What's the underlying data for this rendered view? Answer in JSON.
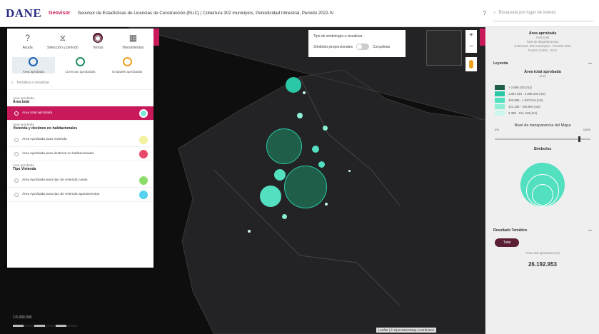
{
  "header": {
    "logo": "DANE",
    "logo_sub": "",
    "brand": "Geovisor",
    "title": "Geovisor de Estadísticas de Licencias de Construcción (ELIC) | Cobertura 302 municipios, Periodicidad trimestral, Periodo 2022-IV",
    "info": "?",
    "search_placeholder": "Búsqueda por lugar de interés"
  },
  "left_panel": {
    "tabs": [
      {
        "label": "Ayuda",
        "icon": "help-icon"
      },
      {
        "label": "Selección y periodo",
        "icon": "filter-icon"
      },
      {
        "label": "Temas",
        "icon": "layers-icon"
      },
      {
        "label": "Herramientas",
        "icon": "tools-icon"
      }
    ],
    "variables": [
      {
        "label": "Área aprobada",
        "color": "#1a5fb4"
      },
      {
        "label": "Licencias aprobadas",
        "color": "#1f8f5c"
      },
      {
        "label": "Unidades aprobadas",
        "color": "#f0a020"
      }
    ],
    "search_placeholder": "Temática a visualizar",
    "groups": [
      {
        "title": "Área aprobada",
        "subtitle": "Área total",
        "items": [
          {
            "label": "Área total aprobada",
            "color": "#7de8d8",
            "selected": true
          }
        ]
      },
      {
        "title": "Área aprobada",
        "subtitle": "Vivienda y destinos no habitacionales",
        "items": [
          {
            "label": "Área Aprobada para Vivienda",
            "color": "#f4f1a0"
          },
          {
            "label": "Área Aprobada para destinos no habitacionales",
            "color": "#e84a6a"
          }
        ]
      },
      {
        "title": "Área aprobada",
        "subtitle": "Tipo Vivienda",
        "items": [
          {
            "label": "Área Aprobada para tipo de vivienda casas",
            "color": "#8cdc6a"
          },
          {
            "label": "Área Aprobada para tipo de vivienda apartamentos",
            "color": "#54d2ee"
          }
        ]
      }
    ]
  },
  "layer_toggle": {
    "title": "Tipo de simbología a visualizar",
    "left": "Símbolos proporcionales",
    "right": "Coropletas"
  },
  "zoom": {
    "in": "+",
    "out": "−"
  },
  "right_panel": {
    "title": "Área aprobada",
    "subtitle": "Área total",
    "lines": [
      "Total de departamentos",
      "Cobertura: 302 municipios - Periodo 2022",
      "Fuente: DANE - ELIC"
    ],
    "legend_header": "Leyenda",
    "legend_title": "Área total aprobada",
    "legend_unit": "(m2)",
    "legend": [
      {
        "label": "> 2.698.103 (m2)",
        "color": "#1f5f4a"
      },
      {
        "label": "1.087.616 - 2.698.102 (m2)",
        "color": "#2bc7a6"
      },
      {
        "label": "403.985 - 1.087.615 (m2)",
        "color": "#53e0c0"
      },
      {
        "label": "121.194 - 403.984 (m2)",
        "color": "#8df0d6"
      },
      {
        "label": "2.398 - 121.193 (m2)",
        "color": "#cbf7ec"
      }
    ],
    "opacity_label": "Nivel de transparencia del Mapa",
    "opacity_min": "0%",
    "opacity_max": "100%",
    "symbols_label": "Símbolos",
    "results_header": "Resultado Temático",
    "results_button": "Total",
    "results_caption": "Área total aprobada (m2)",
    "results_total": "26.192.953"
  },
  "map": {
    "scale_label": "1:5.000.000",
    "attribution": "Leaflet | © OpenStreetMap contributors"
  }
}
